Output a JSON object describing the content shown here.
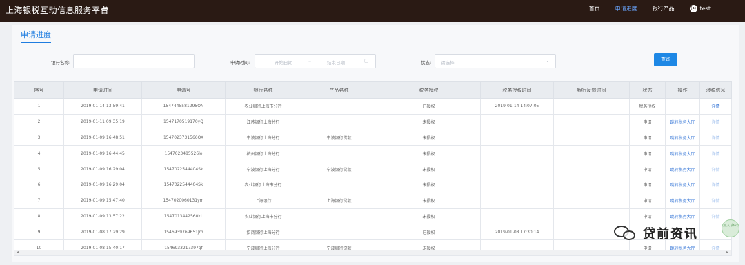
{
  "app": {
    "title": "上海银税互动信息服务平台"
  },
  "nav": {
    "items": [
      {
        "label": "首页",
        "active": false
      },
      {
        "label": "申请进度",
        "active": true
      },
      {
        "label": "银行产品",
        "active": false
      }
    ],
    "user": "test",
    "accent": "#6aa6ff"
  },
  "page": {
    "title": "申请进度"
  },
  "filters": {
    "bank_label": "银行名称:",
    "bank_value": "",
    "time_label": "申请时间:",
    "start_placeholder": "开始日期",
    "sep": "~",
    "end_placeholder": "结束日期",
    "status_label": "状态:",
    "status_placeholder": "请选择",
    "query_label": "查询",
    "brand_color": "#1e88e5"
  },
  "table": {
    "headers": [
      "序号",
      "申请时间",
      "申请号",
      "银行名称",
      "产品名称",
      "税务授权",
      "税务授权时间",
      "银行反馈时间",
      "状态",
      "操作",
      "涉税信息"
    ],
    "rows": [
      {
        "no": "1",
        "time": "2019-01-14 13:59:41",
        "app_no": "1547445581295ON",
        "bank": "农业银行上海市分行",
        "product": "",
        "auth": "已授权",
        "auth_time": "2019-01-14 14:07:05",
        "feedback": "",
        "status": "税务授权",
        "op": "",
        "tax": "详情"
      },
      {
        "no": "2",
        "time": "2019-01-11 09:35:19",
        "app_no": "1547170519170yQ",
        "bank": "江苏银行上海分行",
        "product": "",
        "auth": "未授权",
        "auth_time": "",
        "feedback": "",
        "status": "申请",
        "op": "跳转税务大厅",
        "tax": "详情"
      },
      {
        "no": "3",
        "time": "2019-01-09 16:48:51",
        "app_no": "1547023731566OX",
        "bank": "宁波银行上海分行",
        "product": "宁波银行贷款",
        "auth": "未授权",
        "auth_time": "",
        "feedback": "",
        "status": "申请",
        "op": "跳转税务大厅",
        "tax": "详情"
      },
      {
        "no": "4",
        "time": "2019-01-09 16:44:45",
        "app_no": "1547023485526lo",
        "bank": "杭州银行上海分行",
        "product": "",
        "auth": "未授权",
        "auth_time": "",
        "feedback": "",
        "status": "申请",
        "op": "跳转税务大厅",
        "tax": "详情"
      },
      {
        "no": "5",
        "time": "2019-01-09 16:29:04",
        "app_no": "1547022544404Sk",
        "bank": "宁波银行上海分行",
        "product": "宁波银行贷款",
        "auth": "未授权",
        "auth_time": "",
        "feedback": "",
        "status": "申请",
        "op": "跳转税务大厅",
        "tax": "详情"
      },
      {
        "no": "6",
        "time": "2019-01-09 16:29:04",
        "app_no": "1547022544404Sk",
        "bank": "农业银行上海市分行",
        "product": "",
        "auth": "未授权",
        "auth_time": "",
        "feedback": "",
        "status": "申请",
        "op": "跳转税务大厅",
        "tax": "详情"
      },
      {
        "no": "7",
        "time": "2019-01-09 15:47:40",
        "app_no": "1547020060131ym",
        "bank": "上海银行",
        "product": "上海银行贷款",
        "auth": "未授权",
        "auth_time": "",
        "feedback": "",
        "status": "申请",
        "op": "跳转税务大厅",
        "tax": "详情"
      },
      {
        "no": "8",
        "time": "2019-01-09 13:57:22",
        "app_no": "1547013442560kL",
        "bank": "农业银行上海市分行",
        "product": "",
        "auth": "未授权",
        "auth_time": "",
        "feedback": "",
        "status": "申请",
        "op": "跳转税务大厅",
        "tax": "详情"
      },
      {
        "no": "9",
        "time": "2019-01-08 17:29:29",
        "app_no": "1546939769651Jm",
        "bank": "招商银行上海分行",
        "product": "",
        "auth": "已授权",
        "auth_time": "2019-01-08 17:30:14",
        "feedback": "",
        "status": "",
        "op": "",
        "tax": ""
      },
      {
        "no": "10",
        "time": "2019-01-08 15:40:17",
        "app_no": "1546933217397gf",
        "bank": "宁波银行上海分行",
        "product": "宁波银行贷款",
        "auth": "未授权",
        "auth_time": "",
        "feedback": "",
        "status": "申请",
        "op": "跳转税务大厅",
        "tax": "详情"
      }
    ]
  },
  "watermark": {
    "text": "贷前资讯",
    "badge": "加入\n办公"
  }
}
